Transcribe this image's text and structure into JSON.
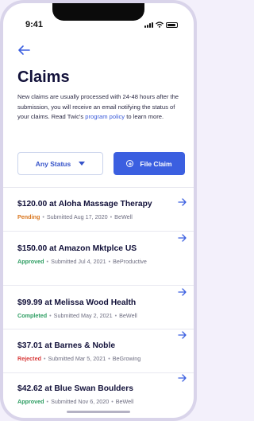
{
  "status_bar": {
    "time": "9:41"
  },
  "header": {
    "title": "Claims"
  },
  "intro": {
    "text_before": "New claims are usually processed with 24-48 hours after the submission, you will receive an email notifying the status of your claims. Read Twic's ",
    "link_text": "program policy",
    "text_after": " to learn more."
  },
  "filters": {
    "status_label": "Any Status",
    "file_claim_label": "File Claim"
  },
  "claims": [
    {
      "title": "$120.00 at Aloha Massage Therapy",
      "status": "Pending",
      "submitted": "Submitted Aug 17, 2020",
      "program": "BeWell"
    },
    {
      "title": "$150.00 at Amazon Mktplce US",
      "status": "Approved",
      "submitted": "Submitted Jul 4, 2021",
      "program": "BeProductive"
    },
    {
      "title": "$99.99 at Melissa Wood Health",
      "status": "Completed",
      "submitted": "Submitted May 2, 2021",
      "program": "BeWell"
    },
    {
      "title": "$37.01 at Barnes & Noble",
      "status": "Rejected",
      "submitted": "Submitted Mar 5, 2021",
      "program": "BeGrowing"
    },
    {
      "title": "$42.62 at Blue Swan Boulders",
      "status": "Approved",
      "submitted": "Submitted Nov 6, 2020",
      "program": "BeWell"
    }
  ],
  "colors": {
    "accent": "#3b5fe0",
    "pending": "#d9761e",
    "approved": "#2e9e63",
    "rejected": "#d83a3a"
  }
}
